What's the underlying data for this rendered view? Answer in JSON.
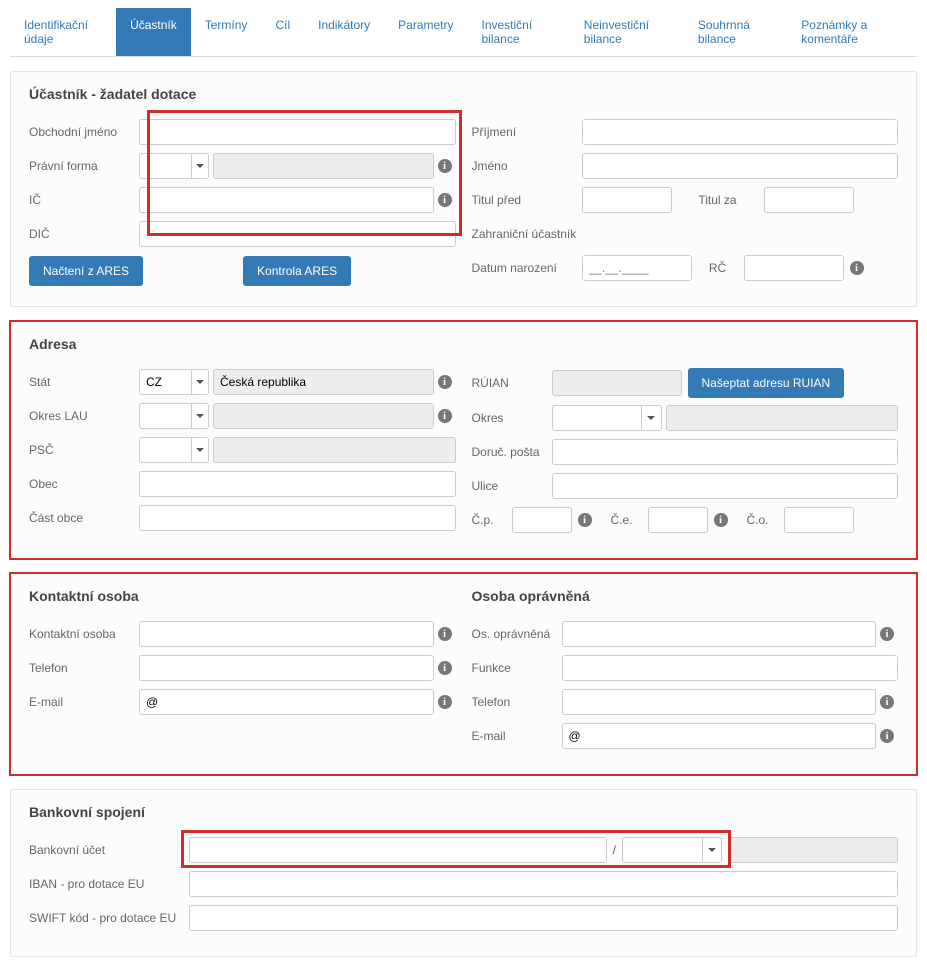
{
  "tabs": [
    "Identifikační údaje",
    "Účastník",
    "Termíny",
    "Cíl",
    "Indikátory",
    "Parametry",
    "Investiční bilance",
    "Neinvestiční bilance",
    "Souhrnná bilance",
    "Poznámky a komentáře"
  ],
  "active_tab_index": 1,
  "ucastnik": {
    "title": "Účastník - žadatel dotace",
    "left": {
      "obchodni_jmeno_lbl": "Obchodní jméno",
      "pravni_forma_lbl": "Právní forma",
      "ic_lbl": "IČ",
      "dic_lbl": "DIČ",
      "obchodni_jmeno": "",
      "pravni_forma_code": "",
      "pravni_forma_text": "",
      "ic": "",
      "dic": ""
    },
    "right": {
      "prijmeni_lbl": "Příjmení",
      "jmeno_lbl": "Jméno",
      "titul_pred_lbl": "Titul před",
      "titul_za_lbl": "Titul za",
      "zahranicni_lbl": "Zahraniční účastník",
      "datum_narozeni_lbl": "Datum narození",
      "rc_lbl": "RČ",
      "prijmeni": "",
      "jmeno": "",
      "titul_pred": "",
      "titul_za": "",
      "datum_narozeni_placeholder": "__.__.____",
      "rc": ""
    },
    "btn_nacteni": "Načtení z ARES",
    "btn_kontrola": "Kontrola ARES"
  },
  "adresa": {
    "title": "Adresa",
    "left": {
      "stat_lbl": "Stát",
      "stat_code": "CZ",
      "stat_text": "Česká republika",
      "okres_lau_lbl": "Okres LAU",
      "okres_lau_code": "",
      "okres_lau_text": "",
      "psc_lbl": "PSČ",
      "psc_code": "",
      "psc_text": "",
      "obec_lbl": "Obec",
      "obec": "",
      "cast_obce_lbl": "Část obce",
      "cast_obce": ""
    },
    "right": {
      "ruian_lbl": "RÚIAN",
      "ruian": "",
      "btn_naseptat": "Našeptat adresu RUIAN",
      "okres_lbl": "Okres",
      "okres_code": "",
      "okres_text": "",
      "doruc_posta_lbl": "Doruč. pošta",
      "doruc_posta": "",
      "ulice_lbl": "Ulice",
      "ulice": "",
      "cp_lbl": "Č.p.",
      "cp": "",
      "ce_lbl": "Č.e.",
      "ce": "",
      "co_lbl": "Č.o.",
      "co": ""
    }
  },
  "kontakt": {
    "left_title": "Kontaktní osoba",
    "right_title": "Osoba oprávněná",
    "left": {
      "kontaktni_osoba_lbl": "Kontaktní osoba",
      "kontaktni_osoba": "",
      "telefon_lbl": "Telefon",
      "telefon": "",
      "email_lbl": "E-mail",
      "email": "@"
    },
    "right": {
      "os_opravnena_lbl": "Os. oprávněná",
      "os_opravnena": "",
      "funkce_lbl": "Funkce",
      "funkce": "",
      "telefon_lbl": "Telefon",
      "telefon": "",
      "email_lbl": "E-mail",
      "email": "@"
    }
  },
  "banka": {
    "title": "Bankovní spojení",
    "bankovni_ucet_lbl": "Bankovní účet",
    "bankovni_ucet_pre": "",
    "bankovni_ucet_sep": "/",
    "bankovni_ucet_code": "",
    "bankovni_ucet_bank": "",
    "iban_lbl": "IBAN - pro dotace EU",
    "iban": "",
    "swift_lbl": "SWIFT kód - pro dotace EU",
    "swift": ""
  }
}
